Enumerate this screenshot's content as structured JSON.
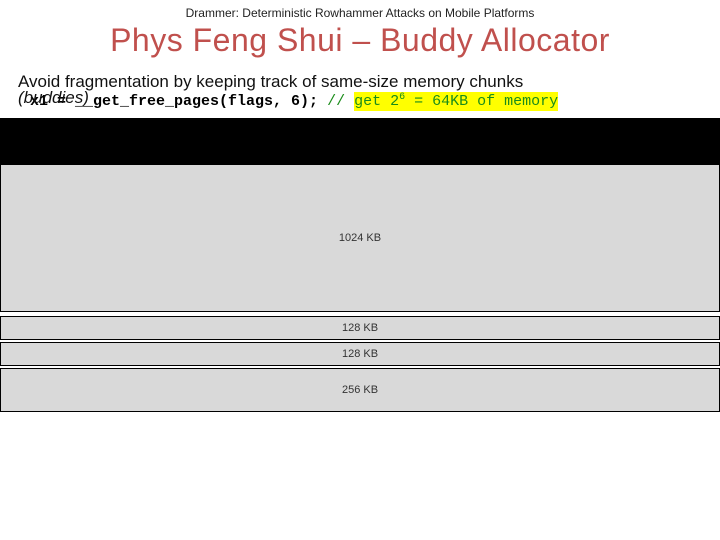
{
  "header": "Drammer: Deterministic Rowhammer Attacks on Mobile Platforms",
  "title": "Phys Feng Shui – Buddy Allocator",
  "desc_line1": "Avoid fragmentation by keeping track of same-size memory chunks",
  "desc_line2": "(buddies)",
  "code": {
    "prefix": "x1 = ",
    "call": "__get_free_pages(flags, 6);",
    "comment_prefix": " // ",
    "hl_part1": "get 2",
    "hl_sup": "6",
    "hl_part2": " = 64KB of memory"
  },
  "blocks": [
    {
      "label": "",
      "class": "block-dark block-1"
    },
    {
      "label": "1024 KB",
      "class": "block-1024"
    },
    {
      "label": "128 KB",
      "class": "block-128"
    },
    {
      "label": "128 KB",
      "class": "block-128"
    },
    {
      "label": "256 KB",
      "class": "block-256"
    }
  ]
}
